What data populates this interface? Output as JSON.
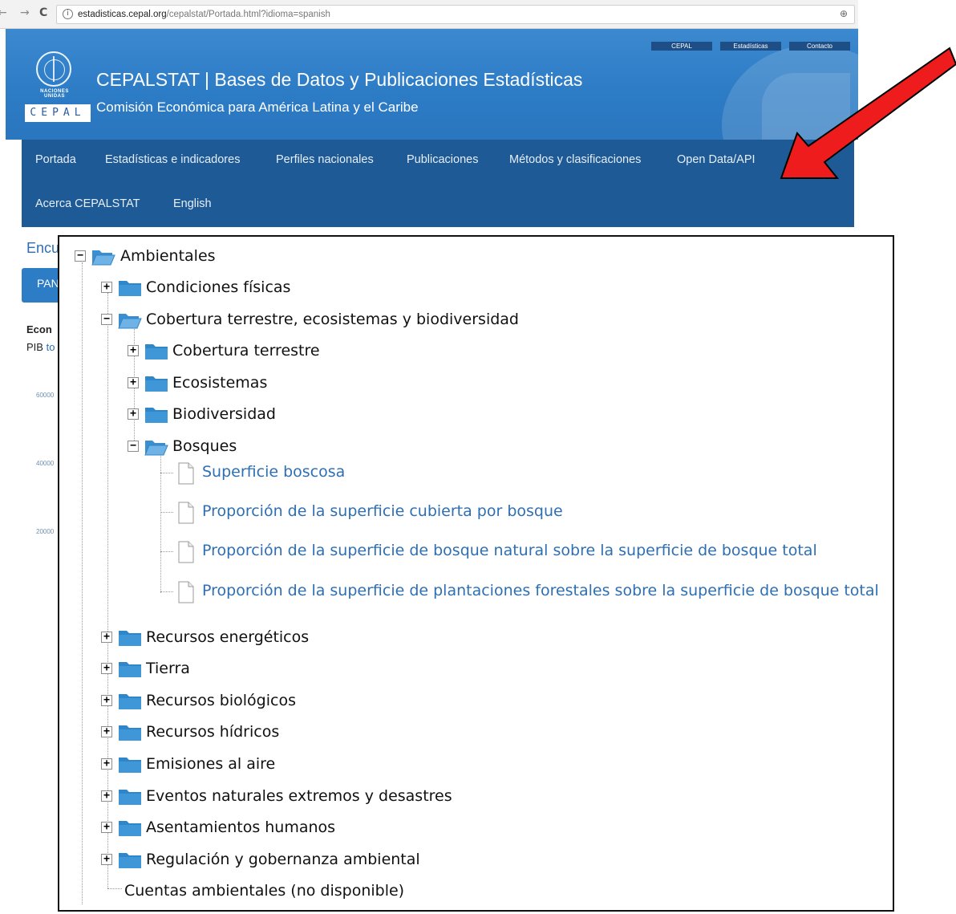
{
  "browser": {
    "back": "←",
    "forward": "→",
    "reload": "C",
    "info_icon": "i",
    "url_host": "estadisticas.cepal.org",
    "url_path": "/cepalstat/Portada.html?idioma=spanish",
    "zoom_icon": "⊕"
  },
  "header": {
    "top_links": [
      "CEPAL",
      "Estadísticas",
      "Contacto"
    ],
    "un_text": "NACIONES UNIDAS",
    "cepal_logo": "CEPAL",
    "title": "CEPALSTAT | Bases de Datos y Publicaciones Estadísticas",
    "subtitle": "Comisión Económica para América Latina y el Caribe"
  },
  "nav": {
    "items": [
      "Portada",
      "Estadísticas e indicadores",
      "Perfiles nacionales",
      "Publicaciones",
      "Métodos y clasificaciones",
      "Open Data/API",
      "Acerca CEPALSTAT",
      "English"
    ]
  },
  "background": {
    "heading_fragment": "Encu",
    "tab_fragment": "PAN",
    "section_fragment": "Econ",
    "pib_prefix": "PIB ",
    "pib_link": "to",
    "axis_ticks": [
      "60000",
      "40000",
      "20000"
    ]
  },
  "tree": {
    "root": "Ambientales",
    "children": [
      "Condiciones físicas",
      "Cobertura terrestre, ecosistemas y biodiversidad",
      "Cobertura terrestre",
      "Ecosistemas",
      "Biodiversidad",
      "Bosques",
      "Superficie boscosa",
      "Proporción de la superficie cubierta por bosque",
      "Proporción de la superficie de bosque natural sobre la superficie de bosque total",
      "Proporción de la superficie de plantaciones forestales sobre la superficie de bosque total",
      "Recursos energéticos",
      "Tierra",
      "Recursos biológicos",
      "Recursos hídricos",
      "Emisiones al aire",
      "Eventos naturales extremos y desastres",
      "Asentamientos humanos",
      "Regulación y gobernanza ambiental",
      "Cuentas ambientales (no disponible)"
    ],
    "expand_symbol": "+",
    "collapse_symbol": "−"
  },
  "colors": {
    "header_blue": "#2d7cc6",
    "nav_blue": "#1e5a95",
    "link_blue": "#2e6fb3",
    "arrow_red": "#ee1c1c",
    "folder_blue": "#2f86c8"
  }
}
